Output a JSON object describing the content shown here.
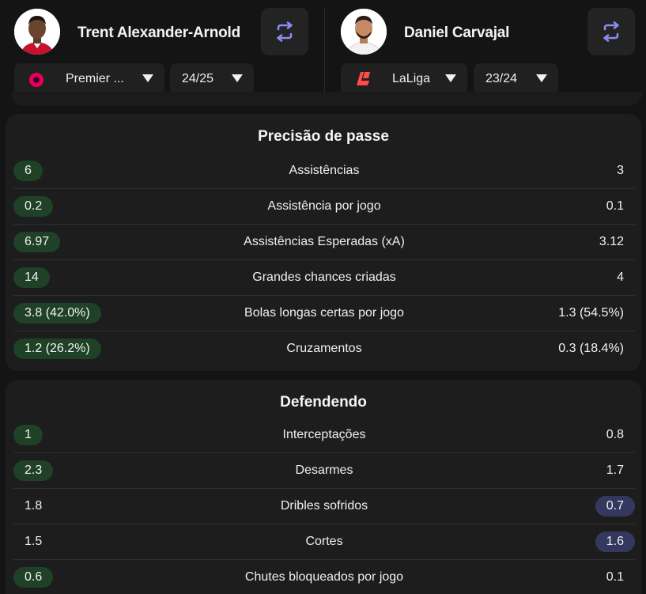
{
  "players": [
    {
      "name": "Trent Alexander-Arnold",
      "league": "Premier ...",
      "league_logo": "premier-league-logo",
      "season": "24/25"
    },
    {
      "name": "Daniel Carvajal",
      "league": "LaLiga",
      "league_logo": "laliga-logo",
      "season": "23/24"
    }
  ],
  "colors": {
    "highlight_left": "#1f4126",
    "highlight_right": "#34385e",
    "swap_icon": "#8a8cf0",
    "background": "#141414",
    "card": "#1d1d1d"
  },
  "sections": [
    {
      "title": "Precisão de passe",
      "rows": [
        {
          "label": "Assistências",
          "left": "6",
          "right": "3",
          "better": "left"
        },
        {
          "label": "Assistência por jogo",
          "left": "0.2",
          "right": "0.1",
          "better": "left"
        },
        {
          "label": "Assistências Esperadas (xA)",
          "left": "6.97",
          "right": "3.12",
          "better": "left"
        },
        {
          "label": "Grandes chances criadas",
          "left": "14",
          "right": "4",
          "better": "left"
        },
        {
          "label": "Bolas longas certas por jogo",
          "left": "3.8 (42.0%)",
          "right": "1.3 (54.5%)",
          "better": "left"
        },
        {
          "label": "Cruzamentos",
          "left": "1.2 (26.2%)",
          "right": "0.3 (18.4%)",
          "better": "left"
        }
      ]
    },
    {
      "title": "Defendendo",
      "rows": [
        {
          "label": "Interceptações",
          "left": "1",
          "right": "0.8",
          "better": "left"
        },
        {
          "label": "Desarmes",
          "left": "2.3",
          "right": "1.7",
          "better": "left"
        },
        {
          "label": "Dribles sofridos",
          "left": "1.8",
          "right": "0.7",
          "better": "right"
        },
        {
          "label": "Cortes",
          "left": "1.5",
          "right": "1.6",
          "better": "right"
        },
        {
          "label": "Chutes bloqueados por jogo",
          "left": "0.6",
          "right": "0.1",
          "better": "left"
        }
      ]
    }
  ]
}
